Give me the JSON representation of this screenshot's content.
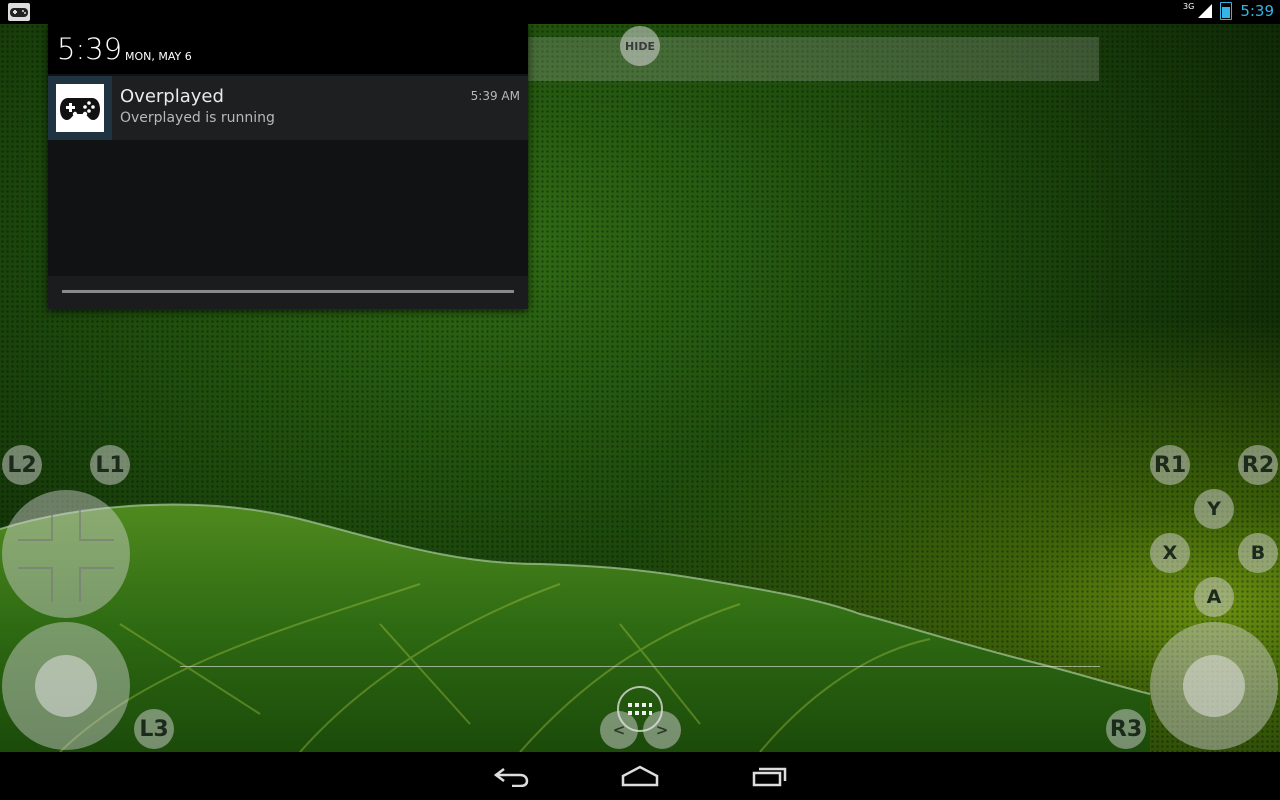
{
  "status_bar": {
    "network_type": "3G",
    "time": "5:39"
  },
  "notification_shade": {
    "time": "5:39",
    "date": "MON, MAY 6",
    "notification": {
      "title": "Overplayed",
      "text": "Overplayed is running",
      "time": "5:39 AM",
      "icon": "gamepad-icon"
    }
  },
  "overlay": {
    "hide_label": "HIDE",
    "buttons": {
      "l2": "L2",
      "l1": "L1",
      "l3": "L3",
      "r1": "R1",
      "r2": "R2",
      "r3": "R3",
      "y": "Y",
      "x": "X",
      "b": "B",
      "a": "A",
      "prev": "<",
      "next": ">"
    }
  },
  "nav_bar": {
    "icons": [
      "back-icon",
      "home-icon",
      "recents-icon"
    ]
  }
}
